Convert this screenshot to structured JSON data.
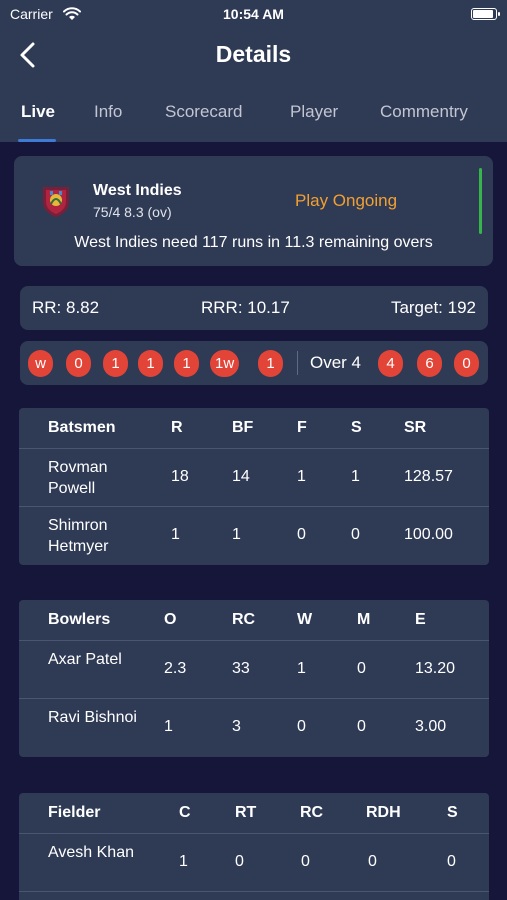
{
  "status_bar": {
    "carrier": "Carrier",
    "time": "10:54 AM"
  },
  "header": {
    "title": "Details"
  },
  "tabs": [
    {
      "label": "Live",
      "active": true
    },
    {
      "label": "Info",
      "active": false
    },
    {
      "label": "Scorecard",
      "active": false
    },
    {
      "label": "Player",
      "active": false
    },
    {
      "label": "Commentry",
      "active": false
    }
  ],
  "match": {
    "team": "West Indies",
    "score": "75/4 8.3 (ov)",
    "status": "Play Ongoing",
    "need": "West Indies need 117 runs in 11.3 remaining overs"
  },
  "rates": {
    "rr": "RR: 8.82",
    "rrr": "RRR: 10.17",
    "target": "Target: 192"
  },
  "balls": {
    "current": [
      "w",
      "0",
      "1",
      "1",
      "1",
      "1w",
      "1"
    ],
    "over_label": "Over 4",
    "previous": [
      "4",
      "6",
      "0"
    ]
  },
  "batsmen": {
    "headers": [
      "Batsmen",
      "R",
      "BF",
      "F",
      "S",
      "SR"
    ],
    "rows": [
      [
        "Rovman Powell",
        "18",
        "14",
        "1",
        "1",
        "128.57"
      ],
      [
        "Shimron Hetmyer",
        "1",
        "1",
        "0",
        "0",
        "100.00"
      ]
    ]
  },
  "bowlers": {
    "headers": [
      "Bowlers",
      "O",
      "RC",
      "W",
      "M",
      "E"
    ],
    "rows": [
      [
        "Axar Patel",
        "2.3",
        "33",
        "1",
        "0",
        "13.20"
      ],
      [
        "Ravi Bishnoi",
        "1",
        "3",
        "0",
        "0",
        "3.00"
      ]
    ]
  },
  "fielders": {
    "headers": [
      "Fielder",
      "C",
      "RT",
      "RC",
      "RDH",
      "S"
    ],
    "rows": [
      [
        "Avesh Khan",
        "1",
        "0",
        "0",
        "0",
        "0"
      ]
    ]
  },
  "colors": {
    "header_bg": "#2f3a55",
    "page_bg": "#16153a",
    "accent": "#3d7bd6",
    "ball": "#e24437",
    "ongoing": "#f2a030",
    "live": "#35b54a"
  }
}
